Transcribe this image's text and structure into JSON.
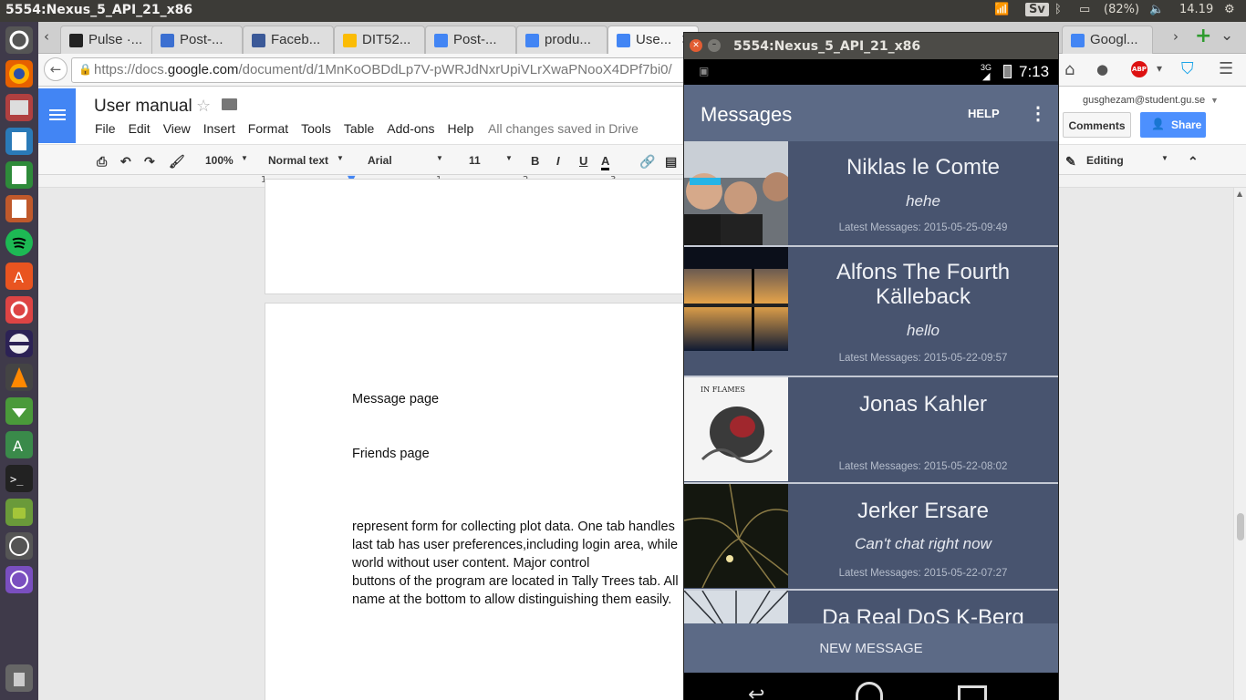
{
  "system": {
    "window_title": "5554:Nexus_5_API_21_x86",
    "lang": "Sv",
    "battery": "(82%)",
    "time": "14.19"
  },
  "browser": {
    "tabs": [
      {
        "label": "Pulse ·...",
        "color": "#222222"
      },
      {
        "label": "Post-...",
        "color": "#3b6fd1"
      },
      {
        "label": "Faceb...",
        "color": "#3b5998"
      },
      {
        "label": "DIT52...",
        "color": "#fbbc05"
      },
      {
        "label": "Post-...",
        "color": "#4285f4"
      },
      {
        "label": "produ...",
        "color": "#4285f4"
      },
      {
        "label": "Use...",
        "color": "#4285f4"
      },
      {
        "label": "Googl...",
        "color": "#4285f4"
      }
    ],
    "url_prefix": "https://docs.",
    "url_domain": "google.com",
    "url_rest": "/document/d/1MnKoOBDdLp7V-pWRJdNxrUpiVLrXwaPNooX4DPf7bi0/"
  },
  "docs": {
    "title": "User manual",
    "menu": [
      "File",
      "Edit",
      "View",
      "Insert",
      "Format",
      "Tools",
      "Table",
      "Add-ons",
      "Help"
    ],
    "saved_status": "All changes saved in Drive",
    "zoom": "100%",
    "style": "Normal text",
    "font": "Arial",
    "size": "11",
    "bold": "B",
    "italic": "I",
    "underline": "U",
    "text_color": "A",
    "editing": "Editing",
    "user_email": "gusghezam@student.gu.se",
    "comments": "Comments",
    "share": "Share",
    "ruler_marks": [
      "1",
      "1",
      "2",
      "3"
    ],
    "lines": [
      "Message page",
      "Friends  page",
      " represent form for collecting plot data. One tab handles",
      "last tab has user preferences,including login area, while",
      "world without user content. Major control",
      "buttons of the program are located in Tally Trees tab. All",
      "name at the bottom to allow distinguishing them easily."
    ]
  },
  "emulator": {
    "title": "5554:Nexus_5_API_21_x86",
    "network": "3G",
    "time": "7:13",
    "app_title": "Messages",
    "help": "HELP",
    "new_message": "NEW MESSAGE",
    "conversations": [
      {
        "name": "Niklas le Comte",
        "message": "hehe",
        "date": "Latest Messages: 2015-05-25-09:49"
      },
      {
        "name": "Alfons The Fourth Källeback",
        "message": "hello",
        "date": "Latest Messages: 2015-05-22-09:57"
      },
      {
        "name": "Jonas Kahler",
        "message": "",
        "date": "Latest Messages: 2015-05-22-08:02"
      },
      {
        "name": "Jerker Ersare",
        "message": "Can't chat right now",
        "date": "Latest Messages: 2015-05-22-07:27"
      },
      {
        "name": "Da Real DoS K-Berg",
        "message": "",
        "date": ""
      }
    ],
    "album_text": "IN FLAMES"
  }
}
